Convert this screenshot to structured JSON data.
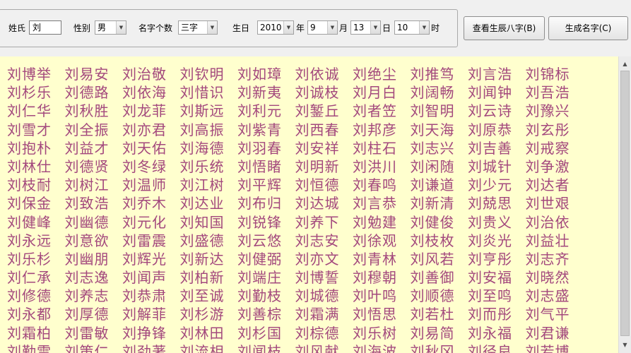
{
  "form": {
    "surname_label": "姓氏",
    "surname_value": "刘",
    "gender_label": "性别",
    "gender_value": "男",
    "name_length_label": "名字个数",
    "name_length_value": "三字",
    "birthday_label": "生日",
    "year_value": "2010",
    "year_unit": "年",
    "month_value": "9",
    "month_unit": "月",
    "day_value": "13",
    "day_unit": "日",
    "hour_value": "10",
    "hour_unit": "时",
    "dropdown_arrow": "▼"
  },
  "buttons": {
    "bazi_label": "查看生辰八字(B)",
    "generate_label": "生成名字(C)"
  },
  "names": [
    "刘博举",
    "刘易安",
    "刘治敬",
    "刘钦明",
    "刘如璋",
    "刘依诚",
    "刘绝尘",
    "刘推笃",
    "刘言浩",
    "刘锦标",
    "刘杉乐",
    "刘德路",
    "刘依海",
    "刘惜识",
    "刘新夷",
    "刘诚枝",
    "刘月白",
    "刘阔畅",
    "刘闻钟",
    "刘吾浩",
    "刘仁华",
    "刘秋胜",
    "刘龙菲",
    "刘斯远",
    "刘利元",
    "刘錾丘",
    "刘者笠",
    "刘智明",
    "刘云诗",
    "刘豫兴",
    "刘雪才",
    "刘全振",
    "刘亦君",
    "刘高振",
    "刘紫青",
    "刘西春",
    "刘邦彦",
    "刘天海",
    "刘原恭",
    "刘玄彤",
    "刘抱朴",
    "刘益才",
    "刘天佑",
    "刘海德",
    "刘羽春",
    "刘安祥",
    "刘柱石",
    "刘志兴",
    "刘吉善",
    "刘戒察",
    "刘林仕",
    "刘德贤",
    "刘冬绿",
    "刘乐统",
    "刘悟睹",
    "刘明新",
    "刘洪川",
    "刘闲随",
    "刘城针",
    "刘争激",
    "刘枝耐",
    "刘树江",
    "刘温师",
    "刘江树",
    "刘平辉",
    "刘恒德",
    "刘春鸣",
    "刘谦道",
    "刘少元",
    "刘达者",
    "刘保金",
    "刘致浩",
    "刘乔木",
    "刘达业",
    "刘布归",
    "刘达城",
    "刘言恭",
    "刘新清",
    "刘兢思",
    "刘世艰",
    "刘健峰",
    "刘幽德",
    "刘元化",
    "刘知国",
    "刘锐锋",
    "刘养下",
    "刘勉建",
    "刘健俊",
    "刘贵义",
    "刘治依",
    "刘永远",
    "刘意欲",
    "刘雷震",
    "刘盛德",
    "刘云悠",
    "刘志安",
    "刘徐观",
    "刘枝枚",
    "刘炎光",
    "刘益壮",
    "刘乐杉",
    "刘幽朋",
    "刘辉光",
    "刘新达",
    "刘健弼",
    "刘亦文",
    "刘青林",
    "刘风若",
    "刘亨彤",
    "刘志齐",
    "刘仁承",
    "刘志逸",
    "刘闻声",
    "刘柏新",
    "刘端庄",
    "刘博誓",
    "刘穆朝",
    "刘善御",
    "刘安福",
    "刘晓然",
    "刘修德",
    "刘养志",
    "刘恭肃",
    "刘至诚",
    "刘勤枝",
    "刘城德",
    "刘叶鸣",
    "刘顺德",
    "刘至鸣",
    "刘志盛",
    "刘永都",
    "刘厚德",
    "刘解菲",
    "刘杉游",
    "刘善棕",
    "刘霜满",
    "刘悟思",
    "刘若杜",
    "刘而彤",
    "刘气平",
    "刘霜柏",
    "刘雷敏",
    "刘挣锋",
    "刘林田",
    "刘杉国",
    "刘棕德",
    "刘乐树",
    "刘易简",
    "刘永福",
    "刘君谦",
    "刘勤雷",
    "刘策仁",
    "刘劲著",
    "刘流相",
    "刘闻枝",
    "刘风献",
    "刘海波",
    "刘秋冈",
    "刘径良",
    "刘若博"
  ],
  "scrollbar": {
    "up_arrow": "▲",
    "down_arrow": "▼"
  }
}
